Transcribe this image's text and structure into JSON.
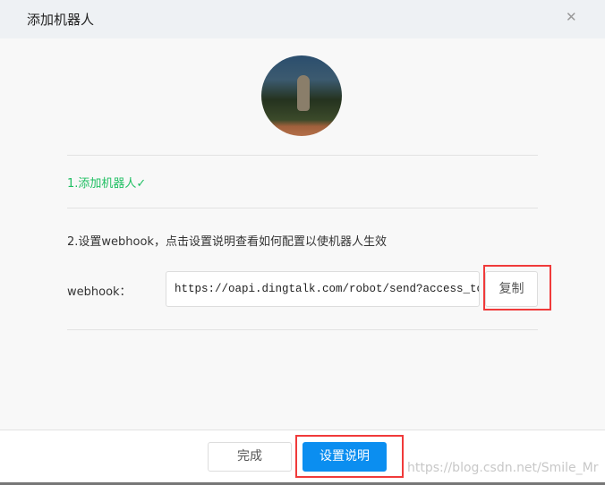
{
  "dialog": {
    "title": "添加机器人",
    "close_icon": "close-icon"
  },
  "steps": {
    "step1": "1.添加机器人✓",
    "step2": "2.设置webhook，点击设置说明查看如何配置以使机器人生效"
  },
  "webhook": {
    "label": "webhook：",
    "value": "https://oapi.dingtalk.com/robot/send?access_tok",
    "copy_label": "复制"
  },
  "footer": {
    "done_label": "完成",
    "help_label": "设置说明"
  },
  "watermark": "https://blog.csdn.net/Smile_Mr",
  "colors": {
    "accent": "#0b8ef0",
    "success": "#1fbf62",
    "highlight": "#f03a3a"
  }
}
